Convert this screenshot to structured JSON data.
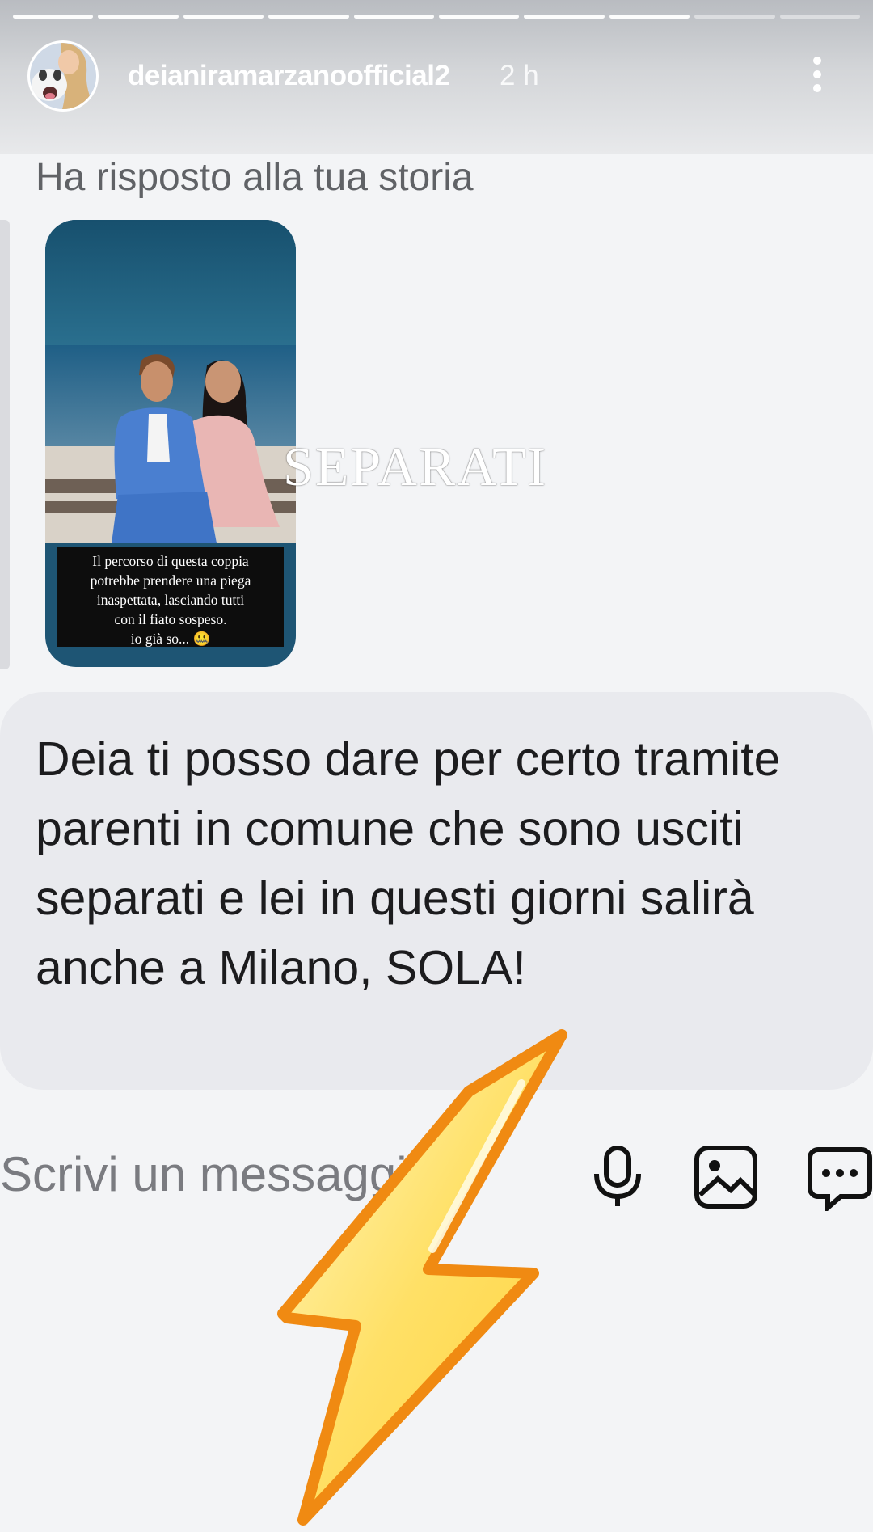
{
  "story": {
    "progress_segments_total": 10,
    "progress_segments_seen": 8
  },
  "header": {
    "username": "deianiramarzanoofficial2",
    "time": "2 h",
    "more_icon": "more-vertical-icon"
  },
  "reply": {
    "label": "Ha risposto alla tua storia"
  },
  "story_card": {
    "caption_lines": [
      "Il percorso di questa coppia",
      "potrebbe prendere una piega",
      "inaspettata, lasciando tutti",
      "con il fiato sospeso.",
      "io già so... 🤐"
    ],
    "watermark": "SEPARATI"
  },
  "message": {
    "text": "Deia ti posso dare per certo tramite parenti in comune che sono usciti separati e lei in questi giorni salirà anche a Milano, SOLA!"
  },
  "composer": {
    "placeholder": "Scrivi un messaggio...",
    "mic_icon": "microphone-icon",
    "gallery_icon": "gallery-icon",
    "sticker_icon": "chat-sticker-icon"
  },
  "sticker": {
    "icon": "lightning-bolt-icon"
  },
  "colors": {
    "header_gradient_top": "#b9bcc1",
    "bubble": "#e9eaee",
    "text": "#1c1c1e",
    "bolt_fill": "#ffd84a",
    "bolt_edge": "#f08a12"
  }
}
